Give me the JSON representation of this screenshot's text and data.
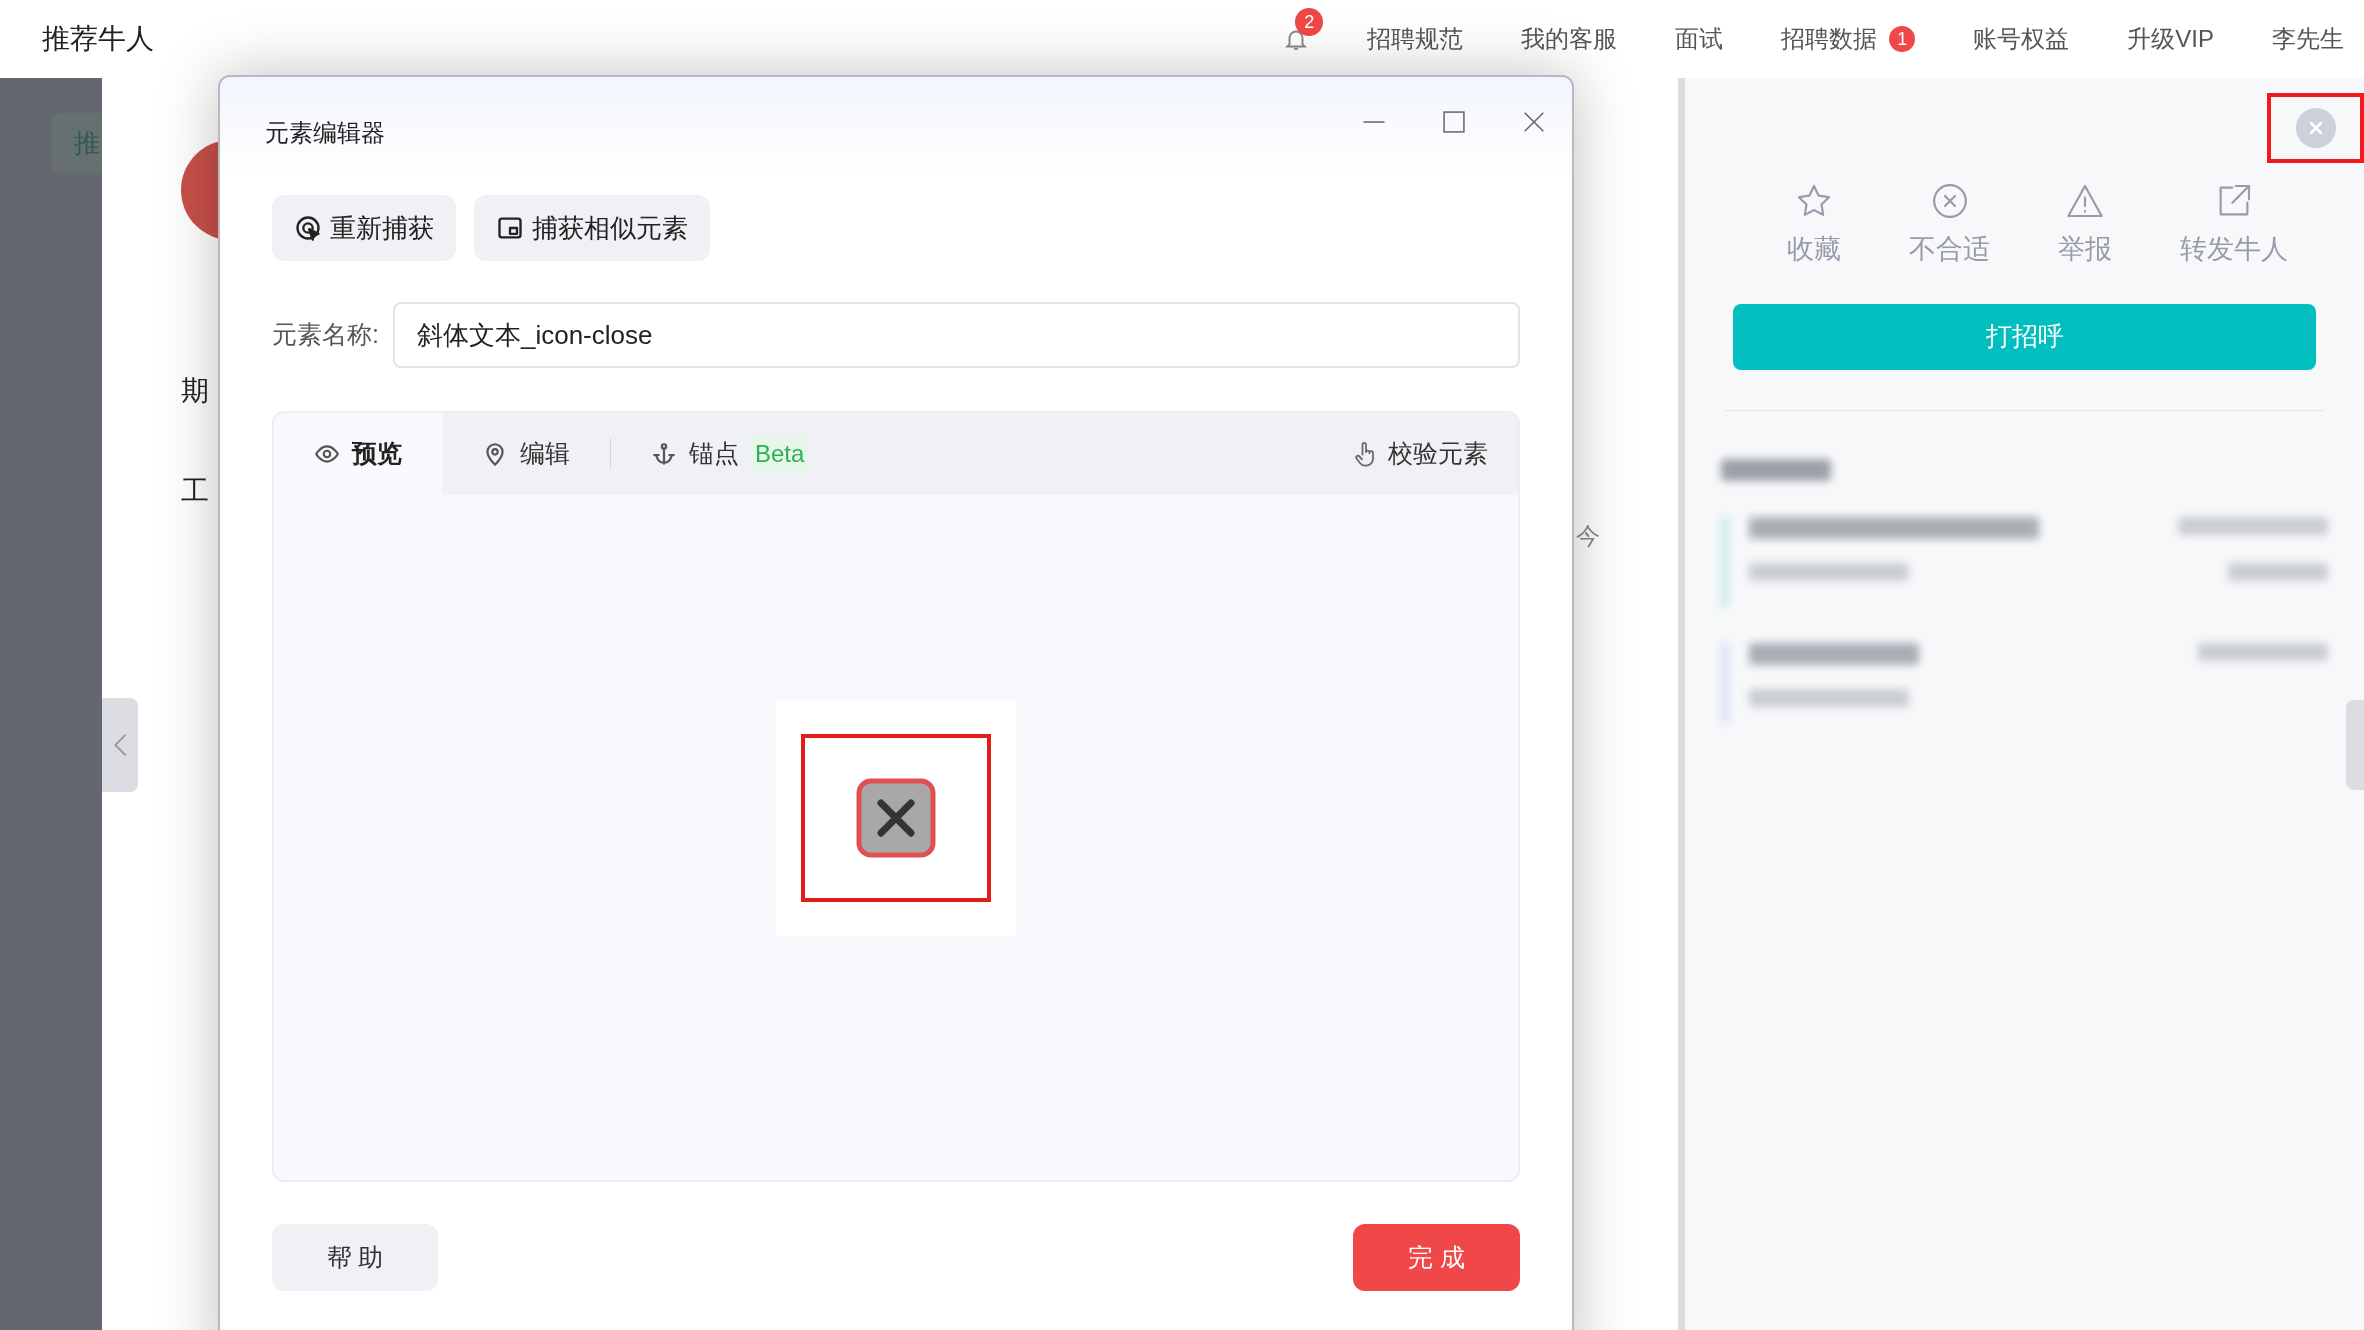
{
  "app_title": "推荐牛人",
  "nav": {
    "notification_badge": "2",
    "items": [
      {
        "label": "招聘规范"
      },
      {
        "label": "我的客服"
      },
      {
        "label": "面试"
      },
      {
        "label": "招聘数据",
        "badge": "1"
      },
      {
        "label": "账号权益"
      },
      {
        "label": "升级VIP"
      },
      {
        "label": "李先生"
      }
    ]
  },
  "background": {
    "tab": "推",
    "fragments": [
      "期",
      "工"
    ],
    "right_fragment": "今"
  },
  "dialog": {
    "title": "元素编辑器",
    "toolbar": [
      {
        "label": "重新捕获",
        "kind": "recapture"
      },
      {
        "label": "捕获相似元素",
        "kind": "similar"
      }
    ],
    "name_field": {
      "label": "元素名称:",
      "value": "斜体文本_icon-close"
    },
    "tabs": [
      {
        "label": "预览",
        "kind": "eye",
        "selected": true
      },
      {
        "label": "编辑",
        "kind": "pin",
        "selected": false
      },
      {
        "label": "锚点",
        "kind": "anchor",
        "badge": "Beta",
        "selected": false
      }
    ],
    "verify": "校验元素",
    "help": "帮 助",
    "done": "完 成"
  },
  "side_panel": {
    "actions": [
      {
        "label": "收藏",
        "kind": "star"
      },
      {
        "label": "不合适",
        "kind": "circle-x"
      },
      {
        "label": "举报",
        "kind": "warning"
      },
      {
        "label": "转发牛人",
        "kind": "share"
      }
    ],
    "greet": "打招呼"
  }
}
